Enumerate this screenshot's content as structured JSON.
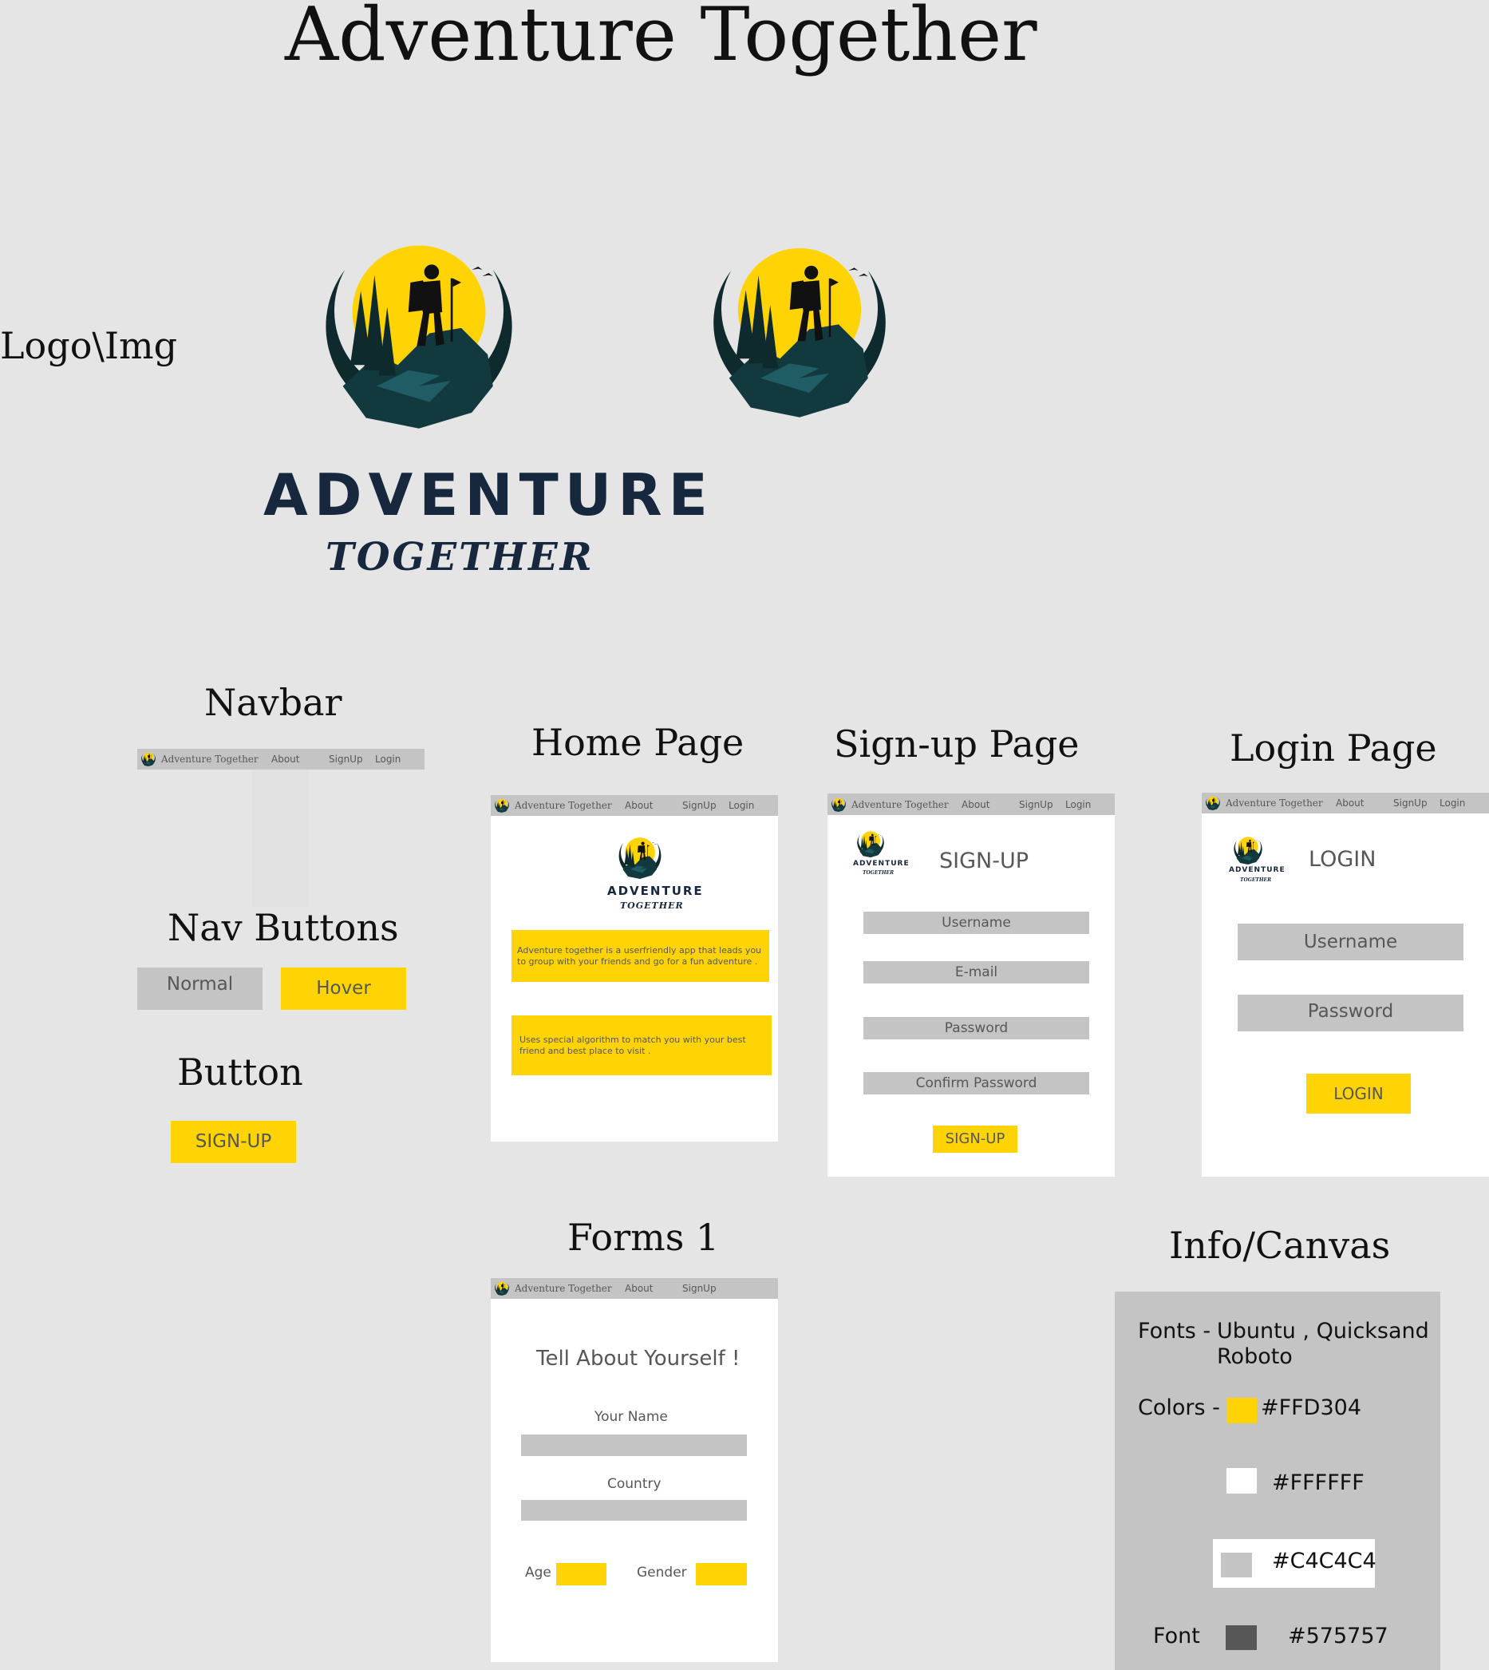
{
  "title": "Adventure Together",
  "sections": {
    "logo": "Logo\\Img",
    "navbar": "Navbar",
    "nav_buttons": "Nav Buttons",
    "button": "Button",
    "home": "Home Page",
    "signup": "Sign-up Page",
    "login": "Login Page",
    "forms": "Forms 1",
    "info": "Info/Canvas"
  },
  "logo": {
    "word1": "ADVENTURE",
    "word2": "TOGETHER"
  },
  "nav": {
    "brand": "Adventure Together",
    "about": "About",
    "signup": "SignUp",
    "login": "Login"
  },
  "nav_buttons": {
    "normal": "Normal",
    "hover": "Hover"
  },
  "button": {
    "label": "SIGN-UP"
  },
  "home": {
    "text1": "Adventure together is a userfriendly app that leads you to group with your friends and go for a fun adventure .",
    "text2": "Uses special algorithm to match you with your best friend and best place to visit ."
  },
  "signup_page": {
    "heading": "SIGN-UP",
    "username": "Username",
    "email": "E-mail",
    "password": "Password",
    "confirm": "Confirm Password",
    "button": "SIGN-UP"
  },
  "login_page": {
    "heading": "LOGIN",
    "username": "Username",
    "password": "Password",
    "button": "LOGIN"
  },
  "forms": {
    "heading": "Tell About Yourself !",
    "name": "Your Name",
    "country": "Country",
    "age": "Age",
    "gender": "Gender"
  },
  "info": {
    "fonts_label": "Fonts -",
    "fonts_line1": "Ubuntu , Quicksand",
    "fonts_line2": "Roboto",
    "colors_label": "Colors -",
    "color1": "#FFD304",
    "color2": "#FFFFFF",
    "color3": "#C4C4C4",
    "font_label": "Font",
    "color4": "#575757"
  },
  "colors": {
    "yellow": "#FFD304",
    "white": "#FFFFFF",
    "grey": "#C4C4C4",
    "font": "#575757",
    "background": "#E5E5E5",
    "logo_dark": "#17273E"
  }
}
